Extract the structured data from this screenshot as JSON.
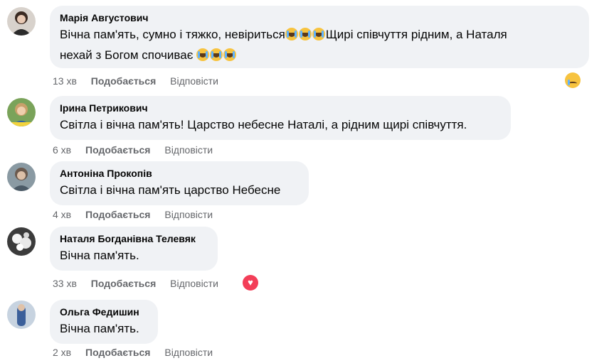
{
  "comments": [
    {
      "author": "Марія Августович",
      "text_line1": "Вічна пам'ять, сумно і тяжко, невіриться",
      "text_line1b": "Щирі співчуття рідним, а Наталя",
      "text_line2": "нехай з Богом спочиває",
      "time": "13 хв",
      "like": "Подобається",
      "reply": "Відповісти",
      "reaction": "sad-reaction-icon"
    },
    {
      "author": "Ірина Петрикович",
      "text": "Світла і вічна пам'ять! Царство небесне Наталі, а рідним щирі співчуття.",
      "time": "6 хв",
      "like": "Подобається",
      "reply": "Відповісти"
    },
    {
      "author": "Антоніна Прокопів",
      "text": "Світла і вічна пам'ять царство Небесне",
      "time": "4 хв",
      "like": "Подобається",
      "reply": "Відповісти"
    },
    {
      "author": "Наталя Богданівна Телевяк",
      "text": "Вічна пам'ять.",
      "time": "33 хв",
      "like": "Подобається",
      "reply": "Відповісти",
      "reaction": "love-reaction-icon"
    },
    {
      "author": "Ольга Федишин",
      "text": "Вічна пам'ять.",
      "time": "2 хв",
      "like": "Подобається",
      "reply": "Відповісти"
    }
  ],
  "colors": {
    "bubble": "#f0f2f5",
    "meta": "#65676b",
    "text": "#050505"
  }
}
